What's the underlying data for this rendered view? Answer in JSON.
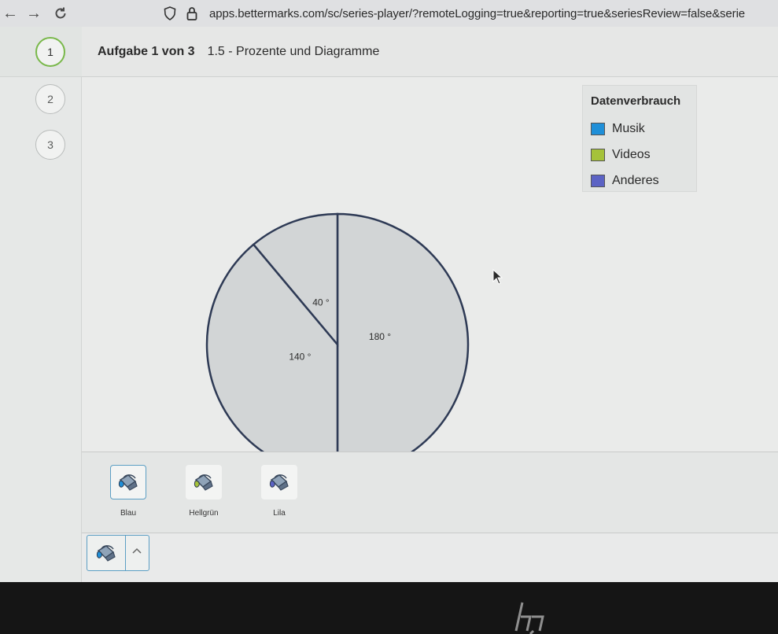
{
  "browser": {
    "url": "apps.bettermarks.com/sc/series-player/?remoteLogging=true&reporting=true&seriesReview=false&serie"
  },
  "sidebar": {
    "steps": [
      {
        "label": "1",
        "active": true
      },
      {
        "label": "2",
        "active": false
      },
      {
        "label": "3",
        "active": false
      }
    ]
  },
  "header": {
    "task_label": "Aufgabe 1 von 3",
    "task_title": "1.5 - Prozente und Diagramme"
  },
  "legend": {
    "title": "Datenverbrauch",
    "items": [
      {
        "label": "Musik",
        "color": "#1f8fd8"
      },
      {
        "label": "Videos",
        "color": "#a5c23a"
      },
      {
        "label": "Anderes",
        "color": "#5c63c4"
      }
    ]
  },
  "pie": {
    "fill": "#d2d5d6",
    "stroke": "#2e3a55",
    "sectors": [
      {
        "label": "180 °",
        "degrees": 180
      },
      {
        "label": "140 °",
        "degrees": 140
      },
      {
        "label": "40 °",
        "degrees": 40
      }
    ]
  },
  "palette": {
    "tools": [
      {
        "label": "Blau",
        "color": "#1f8fd8",
        "selected": true
      },
      {
        "label": "Hellgrün",
        "color": "#a5c23a",
        "selected": false
      },
      {
        "label": "Lila",
        "color": "#5c63c4",
        "selected": false
      }
    ]
  },
  "bottom_tool": {
    "color": "#1f8fd8"
  }
}
